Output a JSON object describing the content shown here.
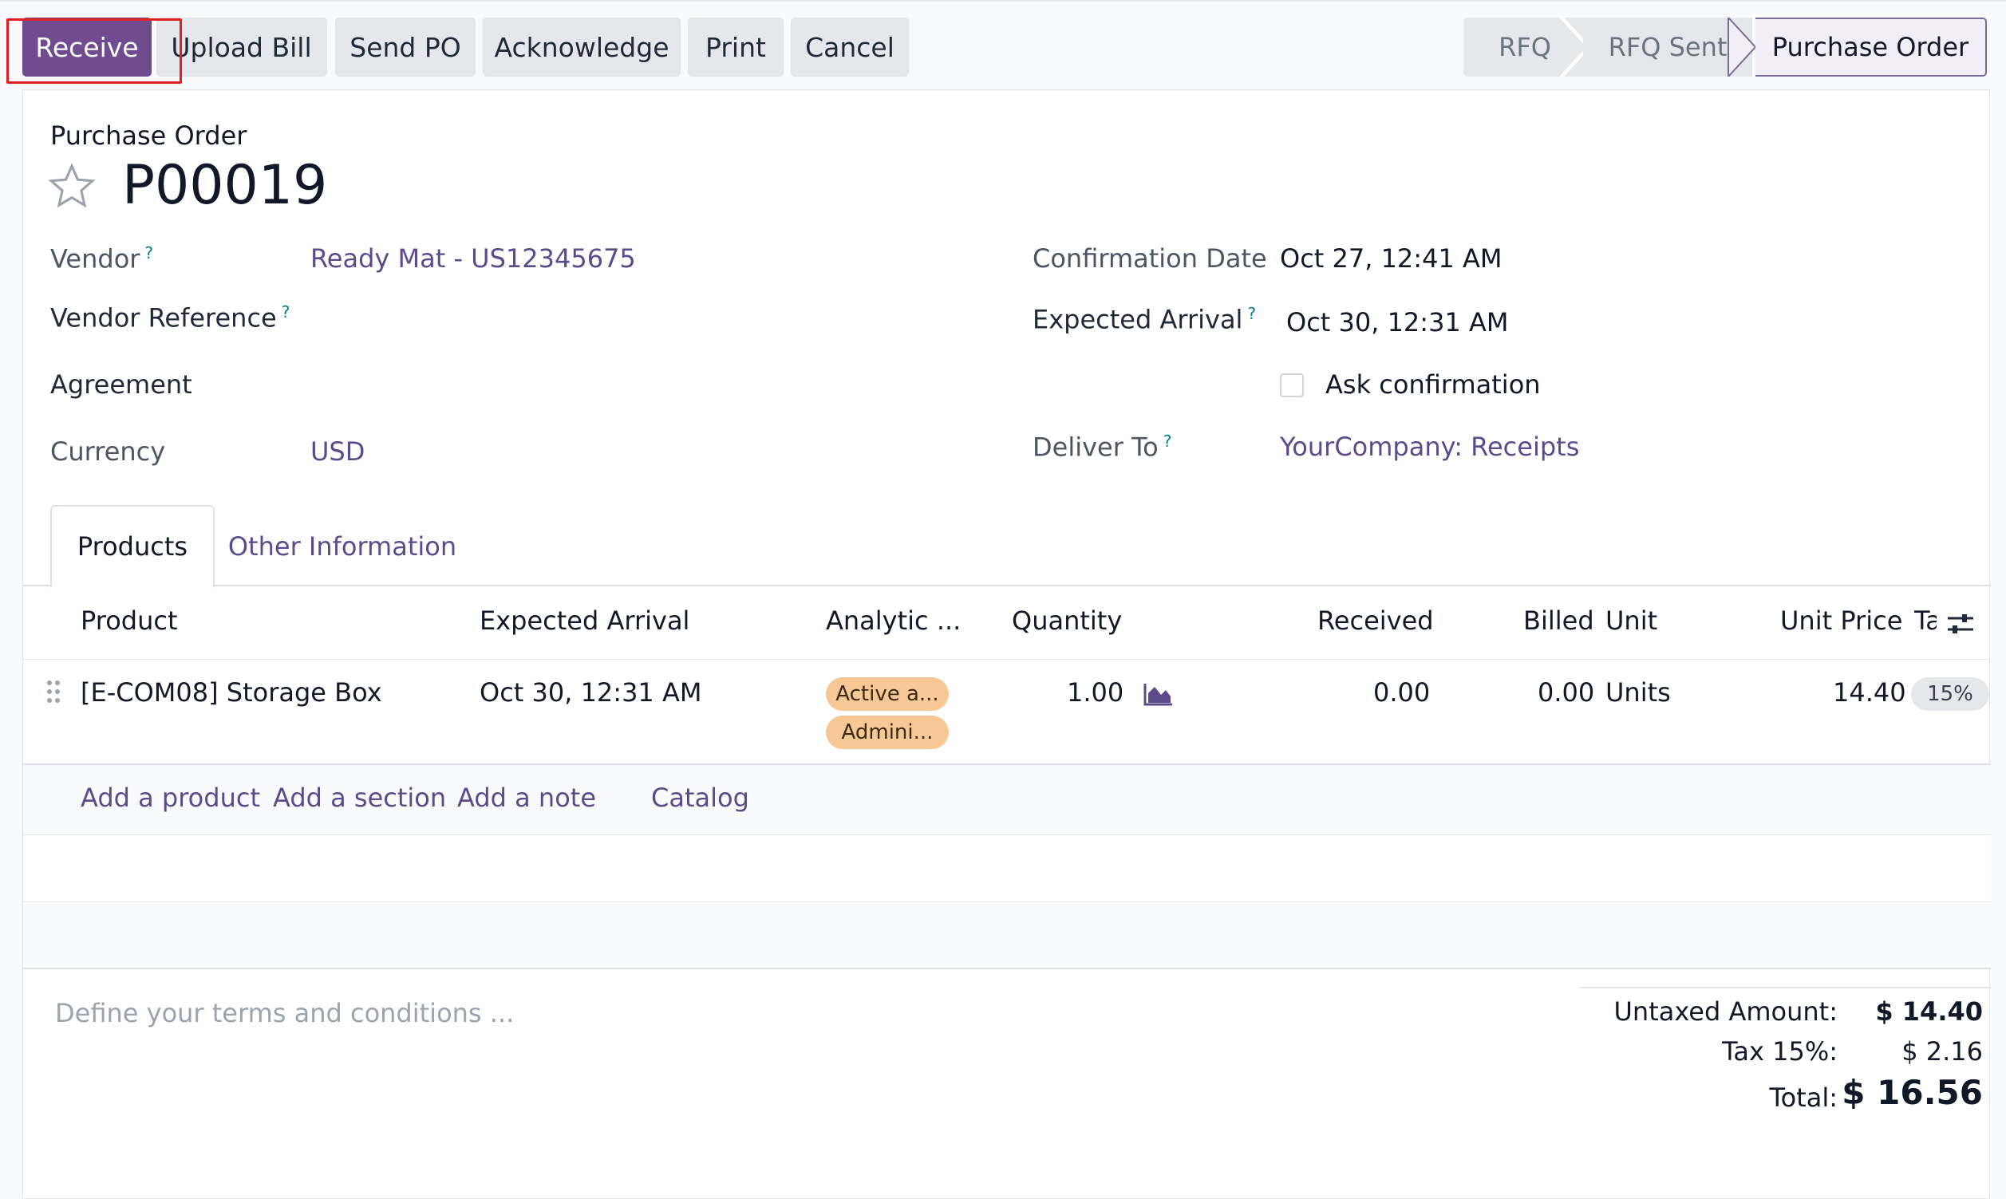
{
  "buttons": {
    "receive": "Receive",
    "upload_bill": "Upload Bill",
    "send_po": "Send PO",
    "acknowledge": "Acknowledge",
    "print": "Print",
    "cancel": "Cancel"
  },
  "status_bar": {
    "stages": [
      "RFQ",
      "RFQ Sent",
      "Purchase Order"
    ],
    "current": "Purchase Order"
  },
  "record": {
    "kind": "Purchase Order",
    "name": "P00019"
  },
  "fields": {
    "vendor_label": "Vendor",
    "vendor_value": "Ready Mat - US12345675",
    "vendor_ref_label": "Vendor Reference",
    "agreement_label": "Agreement",
    "currency_label": "Currency",
    "currency_value": "USD",
    "confirmation_date_label": "Confirmation Date",
    "confirmation_date_value": "Oct 27, 12:41 AM",
    "expected_arrival_label": "Expected Arrival",
    "expected_arrival_value": "Oct 30, 12:31 AM",
    "ask_confirmation_label": "Ask confirmation",
    "deliver_to_label": "Deliver To",
    "deliver_to_value": "YourCompany: Receipts",
    "help_mark": "?"
  },
  "tabs": [
    "Products",
    "Other Information"
  ],
  "table": {
    "headers": {
      "product": "Product",
      "expected_arrival": "Expected Arrival",
      "analytic": "Analytic ...",
      "quantity": "Quantity",
      "received": "Received",
      "billed": "Billed",
      "unit": "Unit",
      "unit_price": "Unit Price",
      "taxes": "Ta"
    },
    "rows": [
      {
        "product": "[E-COM08] Storage Box",
        "expected_arrival": "Oct 30, 12:31 AM",
        "analytic_tags": [
          "Active a...",
          "Admini..."
        ],
        "quantity": "1.00",
        "received": "0.00",
        "billed": "0.00",
        "unit": "Units",
        "unit_price": "14.40",
        "tax": "15%"
      }
    ],
    "add_links": {
      "add_product": "Add a product",
      "add_section": "Add a section",
      "add_note": "Add a note",
      "catalog": "Catalog"
    }
  },
  "terms_placeholder": "Define your terms and conditions ...",
  "totals": {
    "untaxed_label": "Untaxed Amount:",
    "untaxed_value": "$ 14.40",
    "tax_label": "Tax 15%:",
    "tax_value": "$ 2.16",
    "total_label": "Total:",
    "total_value": "$ 16.56"
  },
  "colors": {
    "primary": "#714b8f",
    "link": "#5c4a8a",
    "help": "#017e84",
    "tag": "#f6c896",
    "highlight": "#e02020"
  }
}
